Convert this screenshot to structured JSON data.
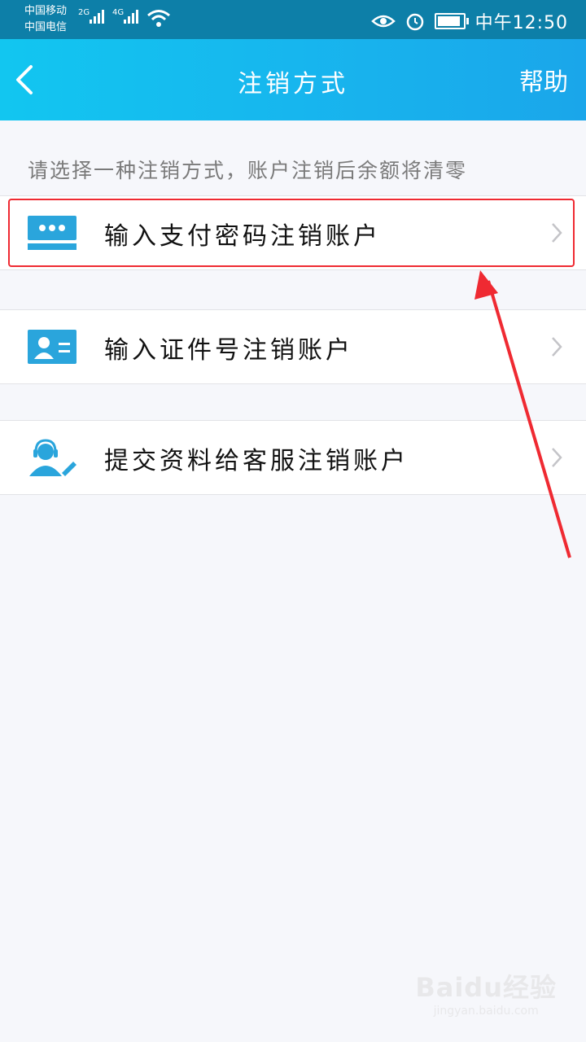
{
  "status_bar": {
    "carrier_1": "中国移动",
    "carrier_2": "中国电信",
    "net_1": "2G",
    "net_2": "4G",
    "time": "中午12:50",
    "icons": [
      "eye-icon",
      "alarm-icon",
      "battery-icon",
      "wifi-icon",
      "signal-icon"
    ]
  },
  "header": {
    "back_icon": "chevron-left-icon",
    "title": "注销方式",
    "help": "帮助"
  },
  "hint": "请选择一种注销方式，账户注销后余额将清零",
  "options": [
    {
      "label": "输入支付密码注销账户",
      "icon": "password-dots-icon",
      "highlighted": true
    },
    {
      "label": "输入证件号注销账户",
      "icon": "id-card-icon",
      "highlighted": false
    },
    {
      "label": "提交资料给客服注销账户",
      "icon": "customer-service-icon",
      "highlighted": false
    }
  ],
  "annotation": {
    "color": "#ef2a32"
  },
  "watermark": {
    "brand": "Baidu经验",
    "site": "jingyan.baidu.com"
  },
  "colors": {
    "accent": "#17b6ee",
    "icon": "#2aa5dc",
    "background": "#f6f7fb"
  }
}
